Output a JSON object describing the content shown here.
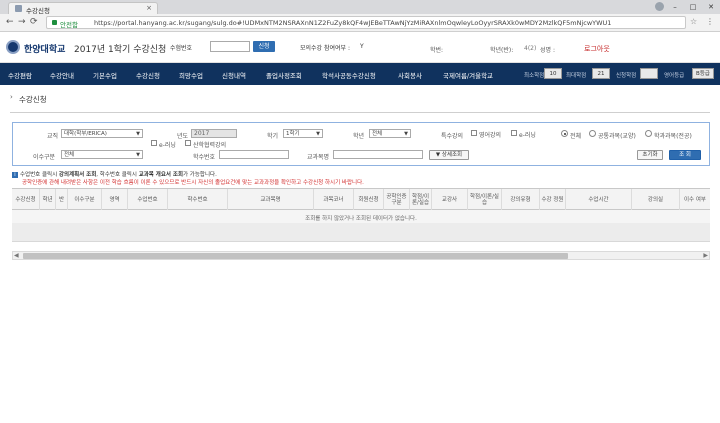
{
  "browser": {
    "tab_title": "수강신청",
    "tab_close": "×",
    "secure_label": "안전함",
    "url": "https://portal.hanyang.ac.kr/sugang/sulg.do#!UDMxNTM2NSRAXnN1Z2FuZy8kQF4wJEBeTTAwNjYzMiRAXnlmOqwleyLoOyyrSRAXk0wMDY2MzlkQF5mNjcwYWU1",
    "win_min": "–",
    "win_max": "□",
    "win_close": "✕"
  },
  "header": {
    "logo_text": "한양대학교",
    "term_title": "2017년 1학기 수강신청",
    "stdno_label": "수험번호",
    "confirm_label": "신청",
    "mock_label": "모의수강 참여여부 :",
    "mock_value": "Y",
    "major_label": "학번:",
    "year_label": "학년(반):",
    "year_value": "4(2)",
    "name_label": "성명 :",
    "logout_label": "로그아웃"
  },
  "nav": {
    "items": [
      "수강편람",
      "수강안내",
      "기본수업",
      "수강신청",
      "희망수업",
      "신청내역",
      "졸업사정조회",
      "학석사공동수강신청",
      "사회봉사",
      "국제여름/겨울학교"
    ],
    "credit_min_label": "최소학점",
    "credit_min_value": "10",
    "credit_max_label": "최대학점",
    "credit_max_value": "21",
    "credit_applied_label": "신청학점",
    "credit_applied_value": "",
    "eng_label": "영어등급",
    "eng_value": "B등급"
  },
  "page": {
    "title": "수강신청"
  },
  "search": {
    "campus_label": "교직",
    "campus_value": "대학(학부/ERICA)",
    "year_label": "년도",
    "year_value": "2017",
    "term_label": "학기",
    "term_value": "1학기",
    "grade_label": "학년",
    "grade_value": "전체",
    "special_label": "특수강의",
    "chk_english": "영어강의",
    "chk_elearning": "e-러닝",
    "chk_elearning2": "e-러닝",
    "chk_industry": "산학협력강의",
    "radio_all": "전체",
    "radio_common": "공통과목(교양)",
    "radio_major": "학과과목(전공)",
    "course_type_label": "이수구분",
    "course_type_value": "전체",
    "course_no_label": "학수번호",
    "instructor_label": "교과목명",
    "detail_button": "▼ 상세조회",
    "reset_button": "초기화",
    "search_button": "조 회"
  },
  "notice": {
    "line1_prefix": "수업번호 클릭시",
    "line1_bold1": "강의계획서 조회",
    "line1_mid": ", 학수번호 클릭시",
    "line1_bold2": "교과목 개요서 조회",
    "line1_suffix": "가 가능합니다.",
    "line2": "공학인증에 관해 내려받은 사항은 이전 학습 흐름이 이론 수 있으므로 반드시 자신의 졸업요건에 맞는 교과과정을 확인하고 수강신청 하시기 바랍니다."
  },
  "grid": {
    "columns": [
      "수강신청",
      "학년",
      "반",
      "이수구분",
      "영역",
      "수업번호",
      "학수번호",
      "교과목명",
      "과목코너",
      "회원신청",
      "공학인증 구분",
      "학점/이론/실습",
      "교강사",
      "학점/이론/실습",
      "강의유형",
      "수강 정원",
      "수업시간",
      "강의실",
      "이수 여부"
    ],
    "empty_message": "조회를 하지 않았거나 조회된 데이터가 없습니다."
  }
}
